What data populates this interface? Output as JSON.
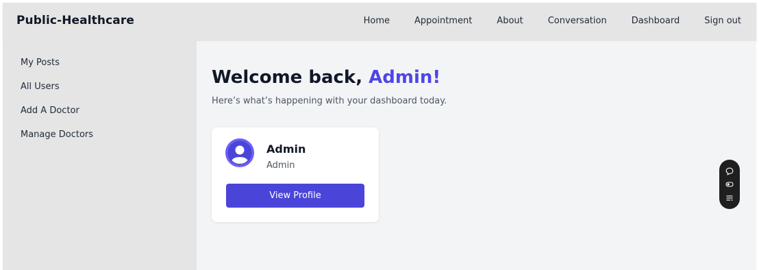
{
  "brand": "Public-Healthcare",
  "nav": {
    "links": [
      "Home",
      "Appointment",
      "About",
      "Conversation",
      "Dashboard",
      "Sign out"
    ]
  },
  "sidebar": {
    "items": [
      "My Posts",
      "All Users",
      "Add A Doctor",
      "Manage Doctors"
    ]
  },
  "main": {
    "welcome_prefix": "Welcome back, ",
    "welcome_name": "Admin!",
    "subtitle": "Here’s what’s happening with your dashboard today."
  },
  "profile_card": {
    "name": "Admin",
    "role": "Admin",
    "button_label": "View Profile"
  },
  "colors": {
    "accent": "#4f46e5",
    "button": "#4a45d8",
    "bar": "#e5e5e5",
    "background": "#f3f4f6"
  },
  "floating_toolbar": {
    "icons": [
      "chat-bubble-icon",
      "toggle-icon",
      "list-settings-icon"
    ]
  }
}
